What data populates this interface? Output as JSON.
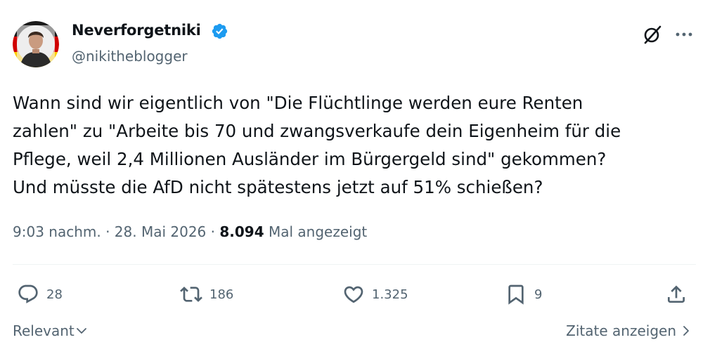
{
  "author": {
    "display_name": "Neverforgetniki",
    "handle": "@nikitheblogger",
    "verified": true
  },
  "tweet": {
    "text": "Wann sind wir eigentlich von \"Die Flüchtlinge werden eure Renten\nzahlen\" zu \"Arbeite bis 70 und zwangsverkaufe dein Eigenheim für die\nPflege, weil 2,4 Millionen Ausländer im Bürgergeld sind\" gekommen?\nUnd müsste die AfD nicht spätestens jetzt auf 51% schießen?"
  },
  "meta": {
    "time": "9:03 nachm.",
    "separator": "·",
    "date": "28. Mai 2026",
    "views_count": "8.094",
    "views_label": "Mal angezeigt"
  },
  "actions": {
    "replies": "28",
    "reposts": "186",
    "likes": "1.325",
    "bookmarks": "9"
  },
  "footer": {
    "sort_label": "Relevant",
    "quotes_label": "Zitate anzeigen"
  },
  "colors": {
    "text": "#0f1419",
    "secondary": "#536471",
    "verified": "#1d9bf0",
    "divider": "#eff3f4"
  },
  "icons": [
    "verified-badge-icon",
    "grok-icon",
    "more-icon",
    "reply-icon",
    "repost-icon",
    "like-icon",
    "bookmark-icon",
    "share-icon",
    "chevron-down-icon",
    "chevron-right-icon"
  ]
}
